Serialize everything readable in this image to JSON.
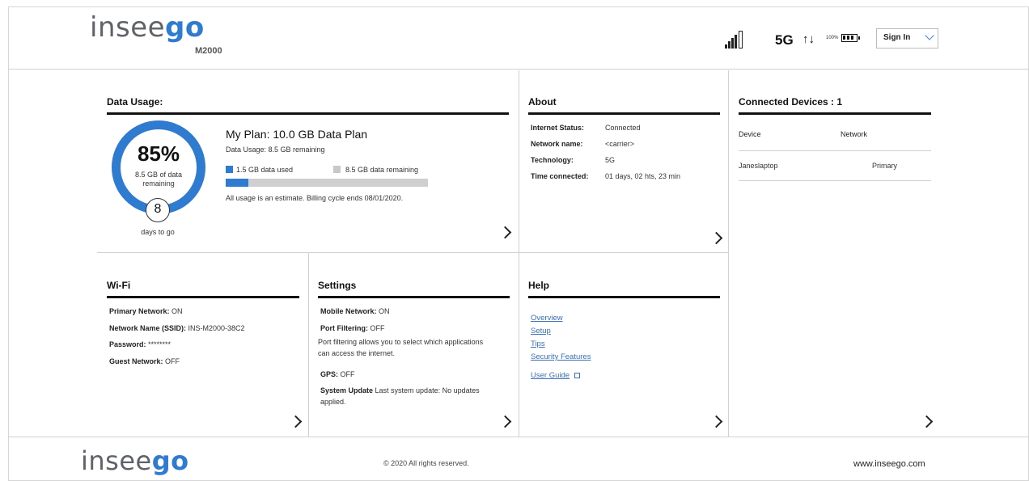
{
  "header": {
    "logo": {
      "a": "insee",
      "b": "go"
    },
    "model": "M2000",
    "network_type": "5G",
    "transfer_arrows": "↑↓",
    "battery_percent": "100%",
    "signal_bars": 5,
    "sign_in_label": "Sign In"
  },
  "data_usage": {
    "title": "Data Usage:",
    "percent": "85%",
    "remaining_text": "8.5 GB of data remaining",
    "remaining_fraction": 0.85,
    "days": "8",
    "days_label": "days to go",
    "plan": "My Plan: 10.0 GB Data Plan",
    "usage_line": "Data Usage: 8.5 GB remaining",
    "legend_used": "1.5 GB data used",
    "legend_remaining": "8.5 GB data remaining",
    "used_fraction": 0.11,
    "note": "All usage is an estimate. Billing cycle ends 08/01/2020.",
    "colors": {
      "used": "#2f7bd0",
      "remaining": "#cfcfcf"
    }
  },
  "about": {
    "title": "About",
    "rows": [
      {
        "label": "Internet Status:",
        "value": "Connected"
      },
      {
        "label": "Network name:",
        "value": "<carrier>"
      },
      {
        "label": "Technology:",
        "value": "5G"
      },
      {
        "label": "Time connected:",
        "value": "01 days, 02 hts, 23 min"
      }
    ]
  },
  "devices": {
    "title": "Connected Devices : 1",
    "col_device": "Device",
    "col_network": "Network",
    "rows": [
      {
        "device": "Janeslaptop",
        "network": "Primary"
      }
    ]
  },
  "wifi": {
    "title": "Wi-Fi",
    "rows": [
      {
        "label": "Primary Network:",
        "value": " ON"
      },
      {
        "label": "Network Name (SSID):",
        "value": " INS-M2000-38C2"
      },
      {
        "label": "Password:",
        "value": " ********"
      },
      {
        "label": "Guest Network:",
        "value": " OFF"
      }
    ]
  },
  "settings": {
    "title": "Settings",
    "mobile_label": "Mobile Network:",
    "mobile_value": " ON",
    "port_label": "Port Filtering:",
    "port_value": " OFF",
    "port_desc_1": "Port filtering allows you to select which applications",
    "port_desc_2": "can access the internet.",
    "gps_label": "GPS:",
    "gps_value": " OFF",
    "update_label": "System Update",
    "update_value_1": " Last system update: No updates",
    "update_value_2": "applied."
  },
  "help": {
    "title": "Help",
    "links": [
      "Overview",
      "Setup",
      "Tips",
      "Security Features"
    ],
    "user_guide": "User Guide"
  },
  "footer": {
    "logo": {
      "a": "insee",
      "b": "go"
    },
    "copyright": "© 2020 All rights reserved.",
    "website": "www.inseego.com"
  }
}
